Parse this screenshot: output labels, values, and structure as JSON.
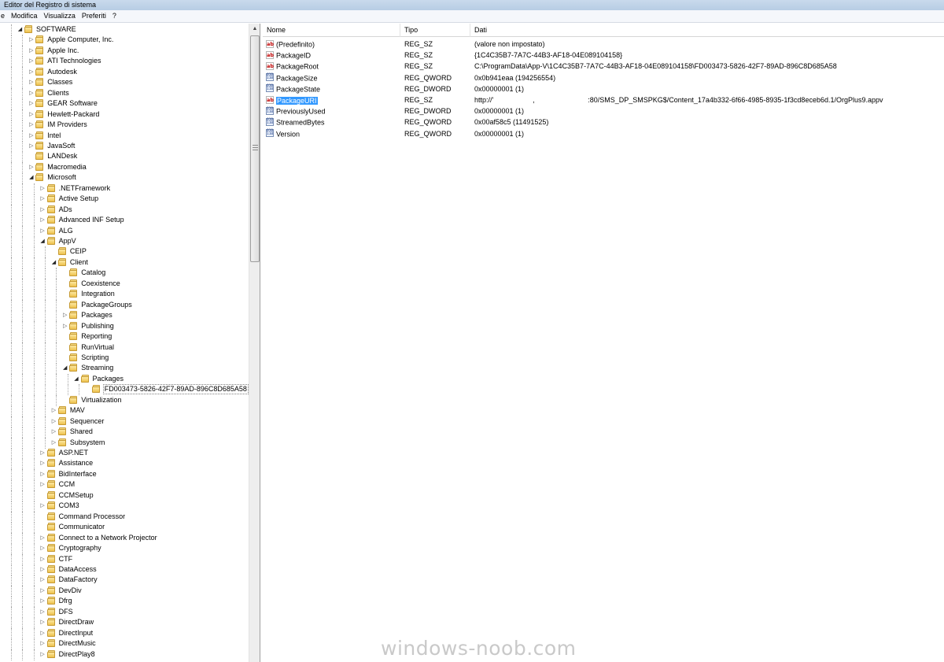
{
  "window": {
    "title": "Editor del Registro di sistema"
  },
  "menu": [
    "e",
    "Modifica",
    "Visualizza",
    "Preferiti",
    "?"
  ],
  "tree": [
    {
      "label": "SOFTWARE",
      "level": 0,
      "state": "open"
    },
    {
      "label": "Apple Computer, Inc.",
      "level": 1,
      "state": "closed"
    },
    {
      "label": "Apple Inc.",
      "level": 1,
      "state": "closed"
    },
    {
      "label": "ATI Technologies",
      "level": 1,
      "state": "closed"
    },
    {
      "label": "Autodesk",
      "level": 1,
      "state": "closed"
    },
    {
      "label": "Classes",
      "level": 1,
      "state": "closed"
    },
    {
      "label": "Clients",
      "level": 1,
      "state": "closed"
    },
    {
      "label": "GEAR Software",
      "level": 1,
      "state": "closed"
    },
    {
      "label": "Hewlett-Packard",
      "level": 1,
      "state": "closed"
    },
    {
      "label": "IM Providers",
      "level": 1,
      "state": "closed"
    },
    {
      "label": "Intel",
      "level": 1,
      "state": "closed"
    },
    {
      "label": "JavaSoft",
      "level": 1,
      "state": "closed"
    },
    {
      "label": "LANDesk",
      "level": 1,
      "state": "leaf"
    },
    {
      "label": "Macromedia",
      "level": 1,
      "state": "closed"
    },
    {
      "label": "Microsoft",
      "level": 1,
      "state": "open"
    },
    {
      "label": ".NETFramework",
      "level": 2,
      "state": "closed"
    },
    {
      "label": "Active Setup",
      "level": 2,
      "state": "closed"
    },
    {
      "label": "ADs",
      "level": 2,
      "state": "closed"
    },
    {
      "label": "Advanced INF Setup",
      "level": 2,
      "state": "closed"
    },
    {
      "label": "ALG",
      "level": 2,
      "state": "closed"
    },
    {
      "label": "AppV",
      "level": 2,
      "state": "open"
    },
    {
      "label": "CEIP",
      "level": 3,
      "state": "leaf"
    },
    {
      "label": "Client",
      "level": 3,
      "state": "open"
    },
    {
      "label": "Catalog",
      "level": 4,
      "state": "leaf"
    },
    {
      "label": "Coexistence",
      "level": 4,
      "state": "leaf"
    },
    {
      "label": "Integration",
      "level": 4,
      "state": "leaf"
    },
    {
      "label": "PackageGroups",
      "level": 4,
      "state": "leaf"
    },
    {
      "label": "Packages",
      "level": 4,
      "state": "closed"
    },
    {
      "label": "Publishing",
      "level": 4,
      "state": "closed"
    },
    {
      "label": "Reporting",
      "level": 4,
      "state": "leaf"
    },
    {
      "label": "RunVirtual",
      "level": 4,
      "state": "leaf"
    },
    {
      "label": "Scripting",
      "level": 4,
      "state": "leaf"
    },
    {
      "label": "Streaming",
      "level": 4,
      "state": "open"
    },
    {
      "label": "Packages",
      "level": 5,
      "state": "open"
    },
    {
      "label": "FD003473-5826-42F7-89AD-896C8D685A58",
      "level": 6,
      "state": "leaf",
      "selected": true
    },
    {
      "label": "Virtualization",
      "level": 4,
      "state": "leaf"
    },
    {
      "label": "MAV",
      "level": 3,
      "state": "closed"
    },
    {
      "label": "Sequencer",
      "level": 3,
      "state": "closed"
    },
    {
      "label": "Shared",
      "level": 3,
      "state": "closed"
    },
    {
      "label": "Subsystem",
      "level": 3,
      "state": "closed"
    },
    {
      "label": "ASP.NET",
      "level": 2,
      "state": "closed"
    },
    {
      "label": "Assistance",
      "level": 2,
      "state": "closed"
    },
    {
      "label": "BidInterface",
      "level": 2,
      "state": "closed"
    },
    {
      "label": "CCM",
      "level": 2,
      "state": "closed"
    },
    {
      "label": "CCMSetup",
      "level": 2,
      "state": "leaf"
    },
    {
      "label": "COM3",
      "level": 2,
      "state": "closed"
    },
    {
      "label": "Command Processor",
      "level": 2,
      "state": "leaf"
    },
    {
      "label": "Communicator",
      "level": 2,
      "state": "leaf"
    },
    {
      "label": "Connect to a Network Projector",
      "level": 2,
      "state": "closed"
    },
    {
      "label": "Cryptography",
      "level": 2,
      "state": "closed"
    },
    {
      "label": "CTF",
      "level": 2,
      "state": "closed"
    },
    {
      "label": "DataAccess",
      "level": 2,
      "state": "closed"
    },
    {
      "label": "DataFactory",
      "level": 2,
      "state": "closed"
    },
    {
      "label": "DevDiv",
      "level": 2,
      "state": "closed"
    },
    {
      "label": "Dfrg",
      "level": 2,
      "state": "closed"
    },
    {
      "label": "DFS",
      "level": 2,
      "state": "closed"
    },
    {
      "label": "DirectDraw",
      "level": 2,
      "state": "closed"
    },
    {
      "label": "DirectInput",
      "level": 2,
      "state": "closed"
    },
    {
      "label": "DirectMusic",
      "level": 2,
      "state": "closed"
    },
    {
      "label": "DirectPlay8",
      "level": 2,
      "state": "closed"
    }
  ],
  "list": {
    "columns": {
      "name": "Nome",
      "type": "Tipo",
      "data": "Dati"
    },
    "rows": [
      {
        "name": "(Predefinito)",
        "type": "REG_SZ",
        "data": "(valore non impostato)",
        "icon": "string-value-icon"
      },
      {
        "name": "PackageID",
        "type": "REG_SZ",
        "data": "{1C4C35B7-7A7C-44B3-AF18-04E089104158}",
        "icon": "string-value-icon"
      },
      {
        "name": "PackageRoot",
        "type": "REG_SZ",
        "data": "C:\\ProgramData\\App-V\\1C4C35B7-7A7C-44B3-AF18-04E089104158\\FD003473-5826-42F7-89AD-896C8D685A58",
        "icon": "string-value-icon"
      },
      {
        "name": "PackageSize",
        "type": "REG_QWORD",
        "data": "0x0b941eaa (194256554)",
        "icon": "binary-value-icon"
      },
      {
        "name": "PackageState",
        "type": "REG_DWORD",
        "data": "0x00000001 (1)",
        "icon": "binary-value-icon"
      },
      {
        "name": "PackageURI",
        "type": "REG_SZ",
        "data": "http://'                    ,                           :80/SMS_DP_SMSPKG$/Content_17a4b332-6f66-4985-8935-1f3cd8eceb6d.1/OrgPlus9.appv",
        "icon": "string-value-icon",
        "selected": true
      },
      {
        "name": "PreviouslyUsed",
        "type": "REG_DWORD",
        "data": "0x00000001 (1)",
        "icon": "binary-value-icon"
      },
      {
        "name": "StreamedBytes",
        "type": "REG_QWORD",
        "data": "0x00af58c5 (11491525)",
        "icon": "binary-value-icon"
      },
      {
        "name": "Version",
        "type": "REG_QWORD",
        "data": "0x00000001 (1)",
        "icon": "binary-value-icon"
      }
    ]
  },
  "watermark": "windows-noob.com",
  "colors": {
    "selection": "#3399ff",
    "folder": "#eec24e",
    "titlebar": "#c9daec"
  }
}
